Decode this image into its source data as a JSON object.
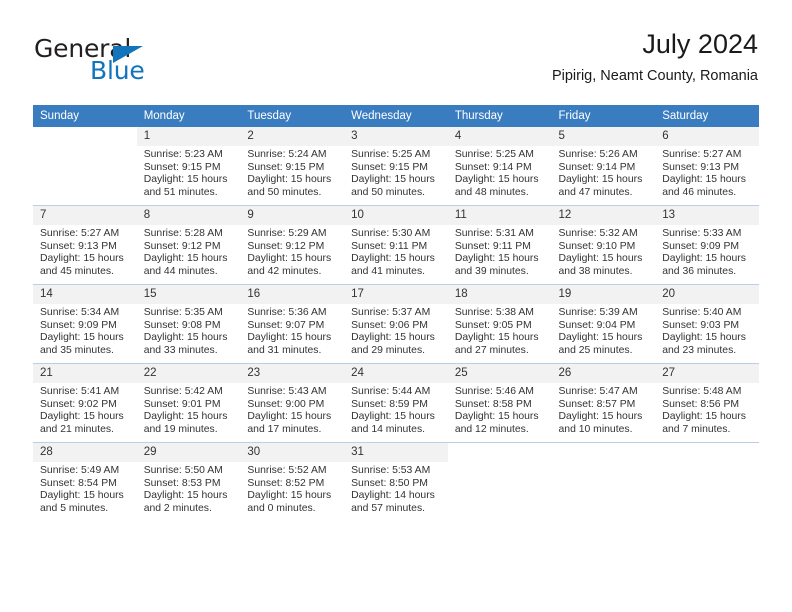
{
  "brand": {
    "name_part1": "General",
    "name_part2": "Blue",
    "accent_color": "#1275bc"
  },
  "header": {
    "title": "July 2024",
    "subtitle": "Pipirig, Neamt County, Romania"
  },
  "calendar": {
    "header_bg": "#3a7cc0",
    "daynum_bg": "#f2f2f2",
    "weekday_headers": [
      "Sunday",
      "Monday",
      "Tuesday",
      "Wednesday",
      "Thursday",
      "Friday",
      "Saturday"
    ],
    "weeks": [
      [
        {
          "day": "",
          "blank": true,
          "sunrise": "",
          "sunset": "",
          "daylight1": "",
          "daylight2": ""
        },
        {
          "day": "1",
          "sunrise": "Sunrise: 5:23 AM",
          "sunset": "Sunset: 9:15 PM",
          "daylight1": "Daylight: 15 hours",
          "daylight2": "and 51 minutes."
        },
        {
          "day": "2",
          "sunrise": "Sunrise: 5:24 AM",
          "sunset": "Sunset: 9:15 PM",
          "daylight1": "Daylight: 15 hours",
          "daylight2": "and 50 minutes."
        },
        {
          "day": "3",
          "sunrise": "Sunrise: 5:25 AM",
          "sunset": "Sunset: 9:15 PM",
          "daylight1": "Daylight: 15 hours",
          "daylight2": "and 50 minutes."
        },
        {
          "day": "4",
          "sunrise": "Sunrise: 5:25 AM",
          "sunset": "Sunset: 9:14 PM",
          "daylight1": "Daylight: 15 hours",
          "daylight2": "and 48 minutes."
        },
        {
          "day": "5",
          "sunrise": "Sunrise: 5:26 AM",
          "sunset": "Sunset: 9:14 PM",
          "daylight1": "Daylight: 15 hours",
          "daylight2": "and 47 minutes."
        },
        {
          "day": "6",
          "sunrise": "Sunrise: 5:27 AM",
          "sunset": "Sunset: 9:13 PM",
          "daylight1": "Daylight: 15 hours",
          "daylight2": "and 46 minutes."
        }
      ],
      [
        {
          "day": "7",
          "sunrise": "Sunrise: 5:27 AM",
          "sunset": "Sunset: 9:13 PM",
          "daylight1": "Daylight: 15 hours",
          "daylight2": "and 45 minutes."
        },
        {
          "day": "8",
          "sunrise": "Sunrise: 5:28 AM",
          "sunset": "Sunset: 9:12 PM",
          "daylight1": "Daylight: 15 hours",
          "daylight2": "and 44 minutes."
        },
        {
          "day": "9",
          "sunrise": "Sunrise: 5:29 AM",
          "sunset": "Sunset: 9:12 PM",
          "daylight1": "Daylight: 15 hours",
          "daylight2": "and 42 minutes."
        },
        {
          "day": "10",
          "sunrise": "Sunrise: 5:30 AM",
          "sunset": "Sunset: 9:11 PM",
          "daylight1": "Daylight: 15 hours",
          "daylight2": "and 41 minutes."
        },
        {
          "day": "11",
          "sunrise": "Sunrise: 5:31 AM",
          "sunset": "Sunset: 9:11 PM",
          "daylight1": "Daylight: 15 hours",
          "daylight2": "and 39 minutes."
        },
        {
          "day": "12",
          "sunrise": "Sunrise: 5:32 AM",
          "sunset": "Sunset: 9:10 PM",
          "daylight1": "Daylight: 15 hours",
          "daylight2": "and 38 minutes."
        },
        {
          "day": "13",
          "sunrise": "Sunrise: 5:33 AM",
          "sunset": "Sunset: 9:09 PM",
          "daylight1": "Daylight: 15 hours",
          "daylight2": "and 36 minutes."
        }
      ],
      [
        {
          "day": "14",
          "sunrise": "Sunrise: 5:34 AM",
          "sunset": "Sunset: 9:09 PM",
          "daylight1": "Daylight: 15 hours",
          "daylight2": "and 35 minutes."
        },
        {
          "day": "15",
          "sunrise": "Sunrise: 5:35 AM",
          "sunset": "Sunset: 9:08 PM",
          "daylight1": "Daylight: 15 hours",
          "daylight2": "and 33 minutes."
        },
        {
          "day": "16",
          "sunrise": "Sunrise: 5:36 AM",
          "sunset": "Sunset: 9:07 PM",
          "daylight1": "Daylight: 15 hours",
          "daylight2": "and 31 minutes."
        },
        {
          "day": "17",
          "sunrise": "Sunrise: 5:37 AM",
          "sunset": "Sunset: 9:06 PM",
          "daylight1": "Daylight: 15 hours",
          "daylight2": "and 29 minutes."
        },
        {
          "day": "18",
          "sunrise": "Sunrise: 5:38 AM",
          "sunset": "Sunset: 9:05 PM",
          "daylight1": "Daylight: 15 hours",
          "daylight2": "and 27 minutes."
        },
        {
          "day": "19",
          "sunrise": "Sunrise: 5:39 AM",
          "sunset": "Sunset: 9:04 PM",
          "daylight1": "Daylight: 15 hours",
          "daylight2": "and 25 minutes."
        },
        {
          "day": "20",
          "sunrise": "Sunrise: 5:40 AM",
          "sunset": "Sunset: 9:03 PM",
          "daylight1": "Daylight: 15 hours",
          "daylight2": "and 23 minutes."
        }
      ],
      [
        {
          "day": "21",
          "sunrise": "Sunrise: 5:41 AM",
          "sunset": "Sunset: 9:02 PM",
          "daylight1": "Daylight: 15 hours",
          "daylight2": "and 21 minutes."
        },
        {
          "day": "22",
          "sunrise": "Sunrise: 5:42 AM",
          "sunset": "Sunset: 9:01 PM",
          "daylight1": "Daylight: 15 hours",
          "daylight2": "and 19 minutes."
        },
        {
          "day": "23",
          "sunrise": "Sunrise: 5:43 AM",
          "sunset": "Sunset: 9:00 PM",
          "daylight1": "Daylight: 15 hours",
          "daylight2": "and 17 minutes."
        },
        {
          "day": "24",
          "sunrise": "Sunrise: 5:44 AM",
          "sunset": "Sunset: 8:59 PM",
          "daylight1": "Daylight: 15 hours",
          "daylight2": "and 14 minutes."
        },
        {
          "day": "25",
          "sunrise": "Sunrise: 5:46 AM",
          "sunset": "Sunset: 8:58 PM",
          "daylight1": "Daylight: 15 hours",
          "daylight2": "and 12 minutes."
        },
        {
          "day": "26",
          "sunrise": "Sunrise: 5:47 AM",
          "sunset": "Sunset: 8:57 PM",
          "daylight1": "Daylight: 15 hours",
          "daylight2": "and 10 minutes."
        },
        {
          "day": "27",
          "sunrise": "Sunrise: 5:48 AM",
          "sunset": "Sunset: 8:56 PM",
          "daylight1": "Daylight: 15 hours",
          "daylight2": "and 7 minutes."
        }
      ],
      [
        {
          "day": "28",
          "sunrise": "Sunrise: 5:49 AM",
          "sunset": "Sunset: 8:54 PM",
          "daylight1": "Daylight: 15 hours",
          "daylight2": "and 5 minutes."
        },
        {
          "day": "29",
          "sunrise": "Sunrise: 5:50 AM",
          "sunset": "Sunset: 8:53 PM",
          "daylight1": "Daylight: 15 hours",
          "daylight2": "and 2 minutes."
        },
        {
          "day": "30",
          "sunrise": "Sunrise: 5:52 AM",
          "sunset": "Sunset: 8:52 PM",
          "daylight1": "Daylight: 15 hours",
          "daylight2": "and 0 minutes."
        },
        {
          "day": "31",
          "sunrise": "Sunrise: 5:53 AM",
          "sunset": "Sunset: 8:50 PM",
          "daylight1": "Daylight: 14 hours",
          "daylight2": "and 57 minutes."
        },
        {
          "day": "",
          "blank": true,
          "sunrise": "",
          "sunset": "",
          "daylight1": "",
          "daylight2": ""
        },
        {
          "day": "",
          "blank": true,
          "sunrise": "",
          "sunset": "",
          "daylight1": "",
          "daylight2": ""
        },
        {
          "day": "",
          "blank": true,
          "sunrise": "",
          "sunset": "",
          "daylight1": "",
          "daylight2": ""
        }
      ]
    ]
  }
}
